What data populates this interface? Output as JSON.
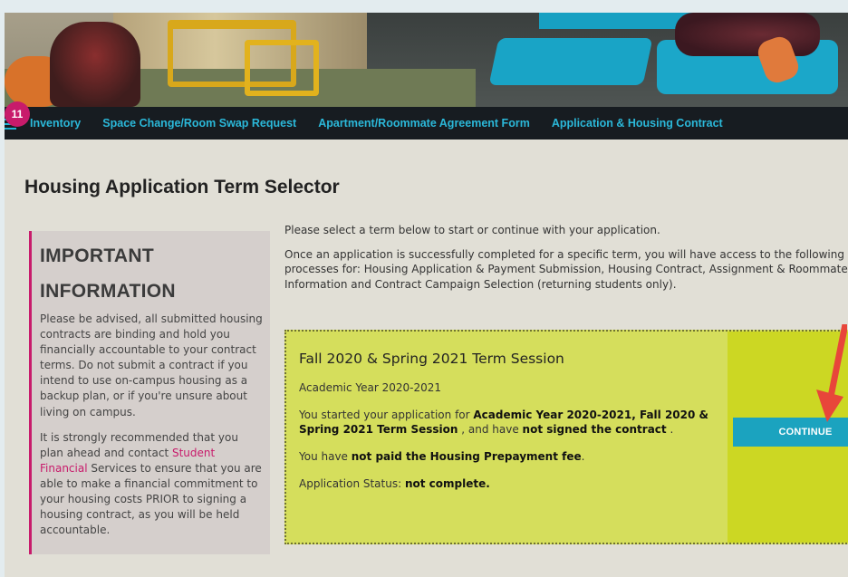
{
  "nav": {
    "badge_count": "11",
    "items": [
      {
        "label": "Inventory"
      },
      {
        "label": "Space Change/Room Swap Request"
      },
      {
        "label": "Apartment/Roommate Agreement Form"
      },
      {
        "label": "Application & Housing Contract"
      }
    ]
  },
  "page_title": "Housing Application Term Selector",
  "important": {
    "title_line1": "IMPORTANT",
    "title_line2": "INFORMATION",
    "para1": "Please be advised, all submitted housing contracts are binding and hold you financially accountable to your contract terms. Do not submit a contract if you intend to use on-campus housing as a backup plan, or if you're unsure about living on campus.",
    "para2_before": "It is strongly recommended that you plan ahead and contact ",
    "para2_link": "Student Financial",
    "para2_after": " Services to ensure that you are able to make a financial commitment to your housing costs PRIOR to signing a housing contract, as you will be held accountable."
  },
  "intro": {
    "line1": "Please select a term below to start or continue with your application.",
    "line2a": "Once an application is successfully completed for a specific term, you will have access to the following hous",
    "line2b": "processes for: Housing Application & Payment Submission, Housing Contract, Assignment & Roommate",
    "line2c": "Information and Contract Campaign Selection (returning students only)."
  },
  "term": {
    "title": "Fall 2020 & Spring 2021 Term Session",
    "academic_year": "Academic Year 2020-2021",
    "started_prefix": "You started your application for ",
    "started_bold": "Academic Year 2020-2021, Fall 2020 & Spring 2021 Term Session",
    "started_mid": " , and have ",
    "started_bold2": "not signed the contract",
    "started_end": " .",
    "paid_prefix": "You have ",
    "paid_bold": "not paid the Housing Prepayment fee",
    "paid_end": ".",
    "status_prefix": "Application Status: ",
    "status_bold": "not complete.",
    "continue_label": "CONTINUE"
  },
  "colors": {
    "accent_pink": "#c81b6b",
    "nav_link": "#2bb8d9",
    "continue_button": "#1ba3bf",
    "arrow": "#e8463a"
  }
}
